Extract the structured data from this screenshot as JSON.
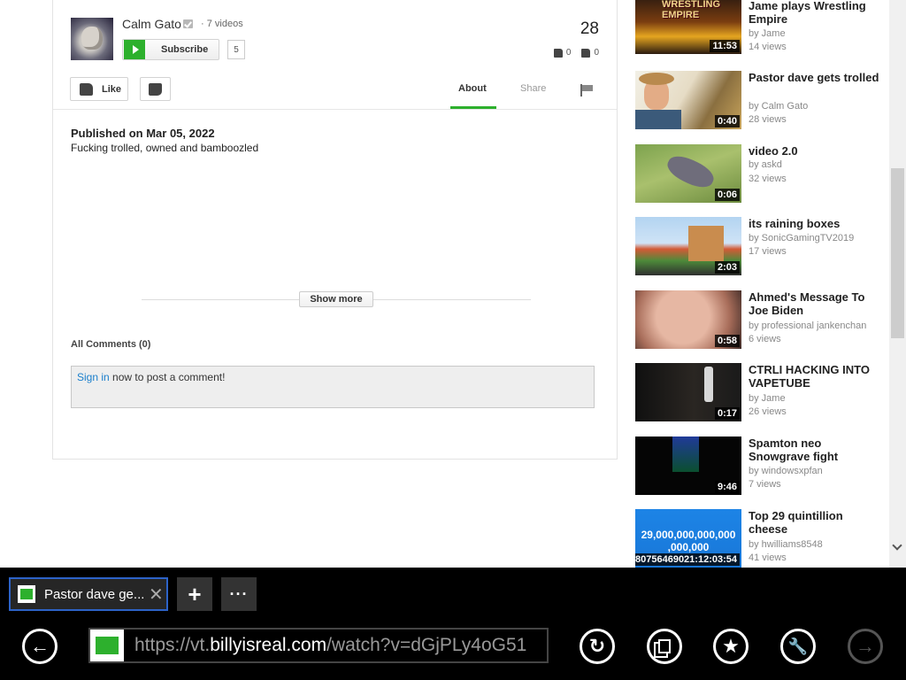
{
  "channel": {
    "name": "Calm Gato",
    "videos": "· 7 videos",
    "subscribe_label": "Subscribe",
    "subscriber_count": "5"
  },
  "stats": {
    "views": "28",
    "likes": "0",
    "dislikes": "0"
  },
  "actions": {
    "like_label": "Like"
  },
  "tabs": {
    "about": "About",
    "share": "Share"
  },
  "description": {
    "published": "Published on Mar 05, 2022",
    "text": "Fucking trolled, owned and bamboozled",
    "show_more": "Show more"
  },
  "comments": {
    "heading": "All Comments (0)",
    "sign_in": "Sign in",
    "prompt": " now to post a comment!"
  },
  "sidebar": {
    "items": [
      {
        "title": "Jame plays Wrestling Empire",
        "by": "by Jame",
        "views": "14 views",
        "duration": "11:53",
        "thumb_text": "WRESTLING EMPIRE"
      },
      {
        "title": "Pastor dave gets trolled",
        "by": "by Calm Gato",
        "views": "28 views",
        "duration": "0:40"
      },
      {
        "title": "video 2.0",
        "by": "by askd",
        "views": "32 views",
        "duration": "0:06"
      },
      {
        "title": "its raining boxes",
        "by": "by SonicGamingTV2019",
        "views": "17 views",
        "duration": "2:03"
      },
      {
        "title": "Ahmed's Message To Joe Biden",
        "by": "by professional jankenchan",
        "views": "6 views",
        "duration": "0:58"
      },
      {
        "title": "CTRLI HACKING INTO VAPETUBE",
        "by": "by Jame",
        "views": "26 views",
        "duration": "0:17"
      },
      {
        "title": "Spamton neo Snowgrave fight",
        "by": "by windowsxpfan",
        "views": "7 views",
        "duration": "9:46"
      },
      {
        "title": "Top 29 quintillion cheese",
        "by": "by hwilliams8548",
        "views": "41 views",
        "duration": "80756469021:12:03:54",
        "thumb_text": "29,000,000,000,000 ,000,000"
      }
    ]
  },
  "browser": {
    "tab_title": "Pastor dave ge...",
    "tab_close": "✕",
    "new_tab": "+",
    "more": "···",
    "url_scheme": "https://vt.",
    "url_host": "billyisreal.com",
    "url_path": "/watch?v=dGjPLy4oG51"
  },
  "colors": {
    "accent": "#2db02d",
    "link": "#1b7fcc",
    "tab_border": "#2d63c8"
  }
}
